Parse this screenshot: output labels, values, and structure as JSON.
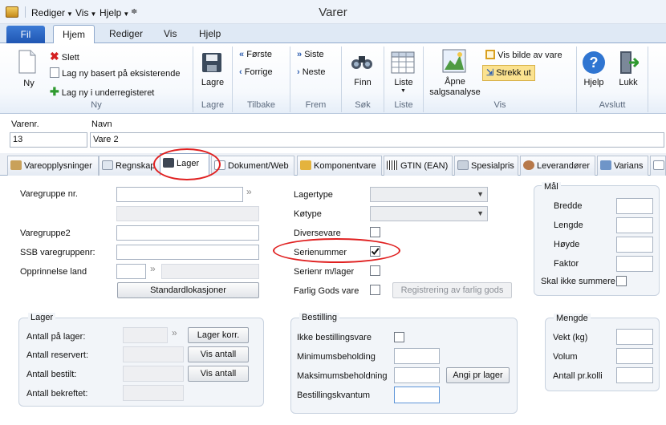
{
  "window": {
    "title": "Varer",
    "quick_access": [
      "Rediger",
      "Vis",
      "Hjelp"
    ]
  },
  "ribbon_tabs": [
    "Fil",
    "Hjem",
    "Rediger",
    "Vis",
    "Hjelp"
  ],
  "ribbon": {
    "ny": {
      "large": "Ny",
      "slett": "Slett",
      "lag_ny_basert": "Lag ny basert på eksisterende",
      "lag_ny_under": "Lag ny i underregisteret",
      "group": "Ny"
    },
    "lagre": {
      "large": "Lagre",
      "group": "Lagre"
    },
    "tilbake": {
      "forste": "Første",
      "forrige": "Forrige",
      "group": "Tilbake"
    },
    "frem": {
      "siste": "Siste",
      "neste": "Neste",
      "group": "Frem"
    },
    "sok": {
      "finn": "Finn",
      "group": "Søk"
    },
    "liste": {
      "liste": "Liste",
      "group": "Liste"
    },
    "vis": {
      "apne1": "Åpne",
      "apne2": "salgsanalyse",
      "vis_bilde": "Vis bilde av vare",
      "strekk_ut": "Strekk ut",
      "group": "Vis"
    },
    "avslutt": {
      "hjelp": "Hjelp",
      "lukk": "Lukk",
      "group": "Avslutt"
    }
  },
  "header_fields": {
    "varenr_label": "Varenr.",
    "varenr_value": "13",
    "navn_label": "Navn",
    "navn_value": "Vare 2"
  },
  "content_tabs": [
    "Vareopplysninger",
    "Regnskap",
    "Lager",
    "Dokument/Web",
    "Komponentvare",
    "GTIN (EAN)",
    "Spesialpris",
    "Leverandører",
    "Varians"
  ],
  "lager_tab": {
    "left": {
      "varegruppe_nr": "Varegruppe nr.",
      "varegruppe2": "Varegruppe2",
      "ssb": "SSB varegruppenr:",
      "opprinnelse": "Opprinnelse land",
      "standardlokasjoner": "Standardlokasjoner",
      "chevron": "»"
    },
    "middle": {
      "lagertype": "Lagertype",
      "kotype": "Køtype",
      "diversevare": "Diversevare",
      "serienummer": "Serienummer",
      "serienr_m_lager": "Serienr m/lager",
      "farlig_gods": "Farlig Gods vare",
      "registrering": "Registrering av farlig gods"
    },
    "mal": {
      "title": "Mål",
      "bredde": "Bredde",
      "lengde": "Lengde",
      "hoyde": "Høyde",
      "faktor": "Faktor",
      "skal_ikke": "Skal ikke summere"
    },
    "lager_group": {
      "title": "Lager",
      "antall_pa_lager": "Antall på lager:",
      "antall_reservert": "Antall reservert:",
      "antall_bestilt": "Antall bestilt:",
      "antall_bekreftet": "Antall bekreftet:",
      "lager_korr": "Lager korr.",
      "vis_antall": "Vis antall"
    },
    "bestilling": {
      "title": "Bestilling",
      "ikke_bestillingsvare": "Ikke bestillingsvare",
      "minimumsbeholding": "Minimumsbeholding",
      "maksimumsbeholdning": "Maksimumsbeholdning",
      "bestillingskvantum": "Bestillingskvantum",
      "angi_pr_lager": "Angi pr lager"
    },
    "mengde": {
      "title": "Mengde",
      "vekt": "Vekt (kg)",
      "volum": "Volum",
      "antall_pr_kolli": "Antall pr.kolli"
    }
  },
  "colors": {
    "accent": "#1f56b3",
    "highlight": "#e02020"
  }
}
